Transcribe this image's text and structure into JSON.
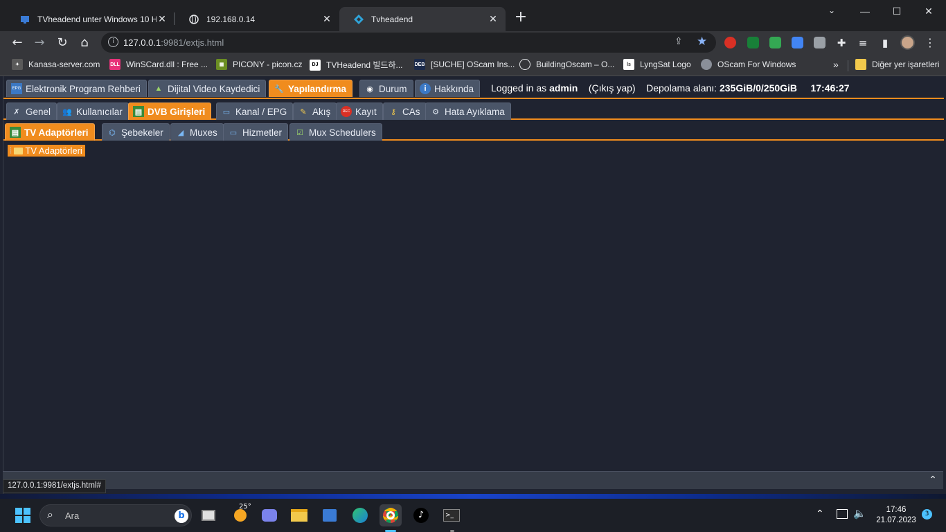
{
  "browser": {
    "tabs": [
      {
        "title": "TVheadend unter Windows 10 H",
        "close": "✕"
      },
      {
        "title": "192.168.0.14",
        "close": "✕"
      },
      {
        "title": "Tvheadend",
        "close": "✕"
      }
    ],
    "new_tab": "+",
    "window_controls": {
      "minimize": "—",
      "maximize": "☐",
      "close": "✕"
    },
    "url_host": "127.0.0.1",
    "url_rest": ":9981/extjs.html",
    "bookmarks": [
      {
        "label": "Kanasa-server.com",
        "icon": "kanasa"
      },
      {
        "label": "WinSCard.dll : Free ...",
        "icon": "dll"
      },
      {
        "label": "PICONY - picon.cz",
        "icon": "picony"
      },
      {
        "label": "TVHeadend 빌드하...",
        "icon": "dj"
      },
      {
        "label": "[SUCHE] OScam Ins...",
        "icon": "deb"
      },
      {
        "label": "BuildingOscam – O...",
        "icon": "globe"
      },
      {
        "label": "LyngSat Logo",
        "icon": "lyngsat"
      },
      {
        "label": "OScam For Windows",
        "icon": "oscam"
      }
    ],
    "bookmarks_more": "»",
    "other_bookmarks": "Diğer yer işaretleri",
    "status_url": "127.0.0.1:9981/extjs.html#"
  },
  "app": {
    "main_tabs": [
      {
        "label": "Elektronik Program Rehberi",
        "icon": "epg-icon"
      },
      {
        "label": "Dijital Video Kaydedici",
        "icon": "dvr-icon"
      },
      {
        "label": "Yapılandırma",
        "icon": "wrench-icon"
      },
      {
        "label": "Durum",
        "icon": "eye-icon"
      },
      {
        "label": "Hakkında",
        "icon": "info-icon"
      }
    ],
    "status": {
      "logged_prefix": "Logged in as",
      "user": "admin",
      "logout": "(Çıkış yap)",
      "storage_label": "Depolama alanı:",
      "storage_value": "235GiB/0/250GiB",
      "time": "17:46:27"
    },
    "config_tabs": [
      {
        "label": "Genel"
      },
      {
        "label": "Kullanıcılar"
      },
      {
        "label": "DVB Girişleri"
      },
      {
        "label": "Kanal / EPG"
      },
      {
        "label": "Akış"
      },
      {
        "label": "Kayıt"
      },
      {
        "label": "CAs"
      },
      {
        "label": "Hata Ayıklama"
      }
    ],
    "dvb_tabs": [
      {
        "label": "TV Adaptörleri"
      },
      {
        "label": "Şebekeler"
      },
      {
        "label": "Muxes"
      },
      {
        "label": "Hizmetler"
      },
      {
        "label": "Mux Schedulers"
      }
    ],
    "tree_root": "TV Adaptörleri"
  },
  "taskbar": {
    "search_placeholder": "Ara",
    "weather": "25°",
    "time": "17:46",
    "date": "21.07.2023",
    "notifications": "3"
  }
}
